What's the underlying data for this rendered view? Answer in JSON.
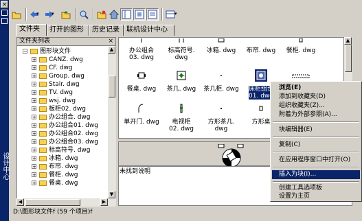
{
  "window": {
    "title": "设计中心",
    "close": "×"
  },
  "tabs": [
    {
      "label": "文件夹",
      "active": true
    },
    {
      "label": "打开的图形",
      "active": false
    },
    {
      "label": "历史记录",
      "active": false
    },
    {
      "label": "联机设计中心",
      "active": false
    }
  ],
  "toolbar": {
    "icons": [
      "load-icon",
      "back-icon",
      "forward-icon",
      "up-icon",
      "search-icon",
      "favorites-icon",
      "home-icon",
      "tree-toggle-icon",
      "preview-toggle-icon",
      "description-toggle-icon",
      "views-icon"
    ]
  },
  "left_panel": {
    "title": "文件夹列表",
    "close": "×",
    "items": [
      {
        "label": "图形块文件",
        "level": 0,
        "expander": "−"
      },
      {
        "label": "CANZ. dwg",
        "level": 1,
        "expander": "+"
      },
      {
        "label": "CF. dwg",
        "level": 1,
        "expander": "+"
      },
      {
        "label": "Group. dwg",
        "level": 1,
        "expander": "+"
      },
      {
        "label": "Stair. dwg",
        "level": 1,
        "expander": "+"
      },
      {
        "label": "TV. dwg",
        "level": 1,
        "expander": "+"
      },
      {
        "label": "wsj. dwg",
        "level": 1,
        "expander": "+"
      },
      {
        "label": "板柜02. dwg",
        "level": 1,
        "expander": "+"
      },
      {
        "label": "办公组合. dwg",
        "level": 1,
        "expander": "+"
      },
      {
        "label": "办公组合01. dwg",
        "level": 1,
        "expander": "+"
      },
      {
        "label": "办公组合02. dwg",
        "level": 1,
        "expander": "+"
      },
      {
        "label": "办公组合03. dwg",
        "level": 1,
        "expander": "+"
      },
      {
        "label": "标高符号. dwg",
        "level": 1,
        "expander": "+"
      },
      {
        "label": "冰箱. dwg",
        "level": 1,
        "expander": "+"
      },
      {
        "label": "布帘. dwg",
        "level": 1,
        "expander": "+"
      },
      {
        "label": "餐柜. dwg",
        "level": 1,
        "expander": "+"
      },
      {
        "label": "餐桌. dwg",
        "level": 1,
        "expander": "+"
      }
    ]
  },
  "grid": {
    "items": [
      {
        "label": [
          "办公组合",
          "03. dwg"
        ],
        "icon": "block-icon",
        "selected": false
      },
      {
        "label": [
          "标高符号.",
          "dwg"
        ],
        "icon": "block-icon",
        "selected": false
      },
      {
        "label": [
          "冰箱. dwg"
        ],
        "icon": "block-icon",
        "selected": false
      },
      {
        "label": [
          "布帘. dwg"
        ],
        "icon": "block-icon",
        "selected": false
      },
      {
        "label": [
          "餐柜. dwg"
        ],
        "icon": "block-icon",
        "selected": false
      },
      {
        "label": [
          "餐桌. dwg"
        ],
        "icon": "table-icon",
        "selected": false
      },
      {
        "label": [
          "茶几. dwg"
        ],
        "icon": "tea-table-icon",
        "selected": false
      },
      {
        "label": [
          "茶几柜. dwg"
        ],
        "icon": "dot-icon",
        "selected": false
      },
      {
        "label": [
          "床柜组合",
          "01. dwg"
        ],
        "icon": "bed-icon",
        "selected": true
      },
      {
        "label": [
          ""
        ],
        "icon": "rect-icon",
        "selected": false
      },
      {
        "label": [
          "单开门. dwg"
        ],
        "icon": "door-icon",
        "selected": false
      },
      {
        "label": [
          "电视柜",
          "02. dwg"
        ],
        "icon": "tv-cabinet-icon",
        "selected": false
      },
      {
        "label": [
          "方形茶几.",
          "dwg"
        ],
        "icon": "dot-icon",
        "selected": false
      },
      {
        "label": [
          "方形桌"
        ],
        "icon": "table-icon",
        "selected": false
      }
    ]
  },
  "description": "未找到说明",
  "context_menu": {
    "items": [
      {
        "label": "浏览(E)",
        "bold": true
      },
      {
        "label": "添加到收藏夹(D)"
      },
      {
        "label": "组织收藏夹(Z)..."
      },
      {
        "label": "附着为外部参照(A)..."
      },
      {
        "sep": true
      },
      {
        "label": "块编辑器(E)"
      },
      {
        "sep": true
      },
      {
        "label": "复制(C)"
      },
      {
        "sep": true
      },
      {
        "label": "在应用程序窗口中打开(O)"
      },
      {
        "sep": true
      },
      {
        "label": "插入为块(I)...",
        "highlight": true
      },
      {
        "sep": true
      },
      {
        "label": "创建工具选项板"
      },
      {
        "label": "设置为主页"
      }
    ]
  },
  "status_bar": {
    "text": "D:\\图形块文件f (59 个项目)f"
  },
  "colors": {
    "titlebar": "#0a246a",
    "face": "#d4d0c8",
    "highlight": "#0a246a",
    "folder": "#f8d050"
  }
}
